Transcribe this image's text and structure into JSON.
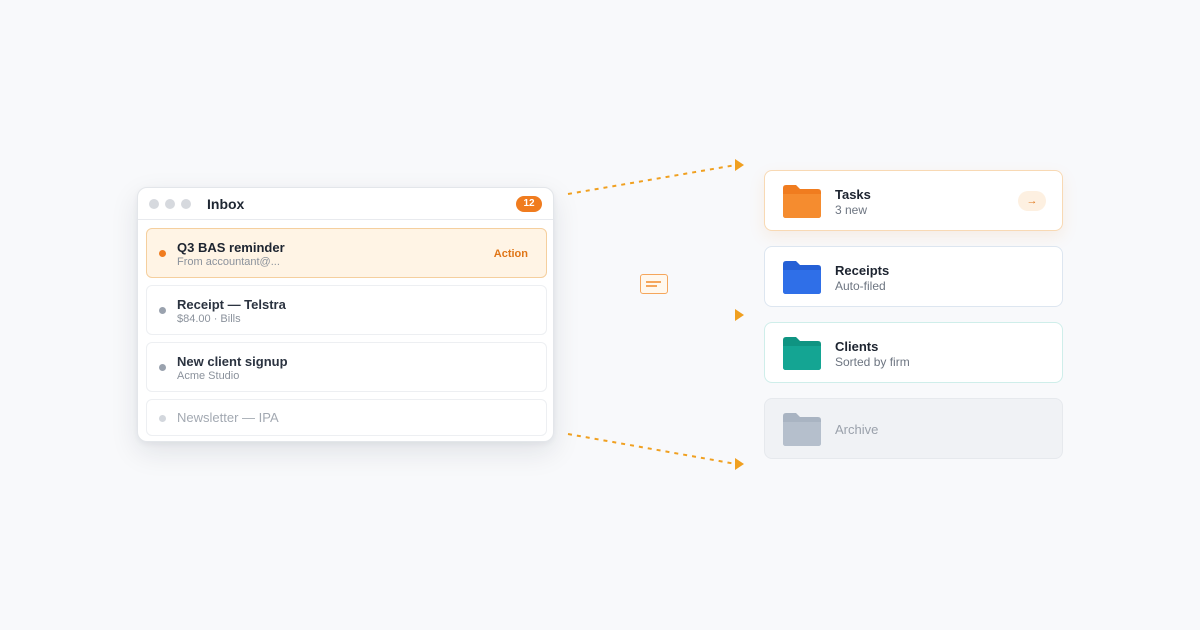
{
  "inbox": {
    "title": "Inbox",
    "count": "12",
    "messages": [
      {
        "subject": "Q3 BAS reminder",
        "meta": "From accountant@...",
        "action": "Action"
      },
      {
        "subject": "Receipt — Telstra",
        "meta": "$84.00 · Bills"
      },
      {
        "subject": "New client signup",
        "meta": "Acme Studio"
      },
      {
        "subject": "Newsletter — IPA"
      }
    ]
  },
  "folders": [
    {
      "name": "Tasks",
      "subtitle": "3 new",
      "icon": "folder-icon",
      "color": "#f07c1f",
      "action_icon": "→"
    },
    {
      "name": "Receipts",
      "subtitle": "Auto-filed",
      "icon": "folder-icon",
      "color": "#2f6fe8"
    },
    {
      "name": "Clients",
      "subtitle": "Sorted by firm",
      "icon": "folder-icon",
      "color": "#14a593"
    },
    {
      "name": "Archive",
      "icon": "folder-icon",
      "color": "#b5bfcc"
    }
  ],
  "colors": {
    "accent": "#f07c1f",
    "connector": "#f0a020",
    "background": "#f8f9fb"
  },
  "icons": {
    "message": "envelope-icon",
    "window_controls": "window-dot-icon"
  }
}
